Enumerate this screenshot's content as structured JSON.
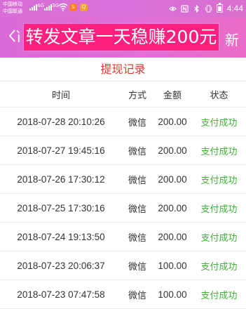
{
  "status_bar": {
    "carrier_1": "中国移动",
    "carrier_2": "中国联通",
    "signal_label_1": "4G",
    "signal_label_2": "3G",
    "time": "4:44",
    "icons": [
      "signal-icon",
      "wifi-icon",
      "app-notification-icon",
      "eye-icon",
      "nfc-icon",
      "bluetooth-icon",
      "vibrate-icon",
      "battery-icon"
    ],
    "app_badge_1": "S",
    "app_badge_2": "Q"
  },
  "navbar": {
    "left_char": "〈",
    "left_partial": "ì",
    "right_partial": "新",
    "banner_text": "转发文章一天稳赚200元",
    "banner_color": "#ff1f7e",
    "bar_color": "#df6ad6"
  },
  "page": {
    "title": "提现记录",
    "title_color": "#e13a2b"
  },
  "table": {
    "headers": [
      "时间",
      "方式",
      "金额",
      "状态"
    ],
    "rows": [
      {
        "time": "2018-07-28 20:10:26",
        "method": "微信",
        "amount": "200.00",
        "status": "支付成功"
      },
      {
        "time": "2018-07-27 19:45:16",
        "method": "微信",
        "amount": "200.00",
        "status": "支付成功"
      },
      {
        "time": "2018-07-26 17:30:12",
        "method": "微信",
        "amount": "200.00",
        "status": "支付成功"
      },
      {
        "time": "2018-07-25 17:30:16",
        "method": "微信",
        "amount": "200.00",
        "status": "支付成功"
      },
      {
        "time": "2018-07-24 19:13:50",
        "method": "微信",
        "amount": "200.00",
        "status": "支付成功"
      },
      {
        "time": "2018-07-23 20:06:37",
        "method": "微信",
        "amount": "100.00",
        "status": "支付成功"
      },
      {
        "time": "2018-07-23 07:47:58",
        "method": "微信",
        "amount": "100.00",
        "status": "支付成功"
      }
    ],
    "status_color": "#44b13a"
  }
}
